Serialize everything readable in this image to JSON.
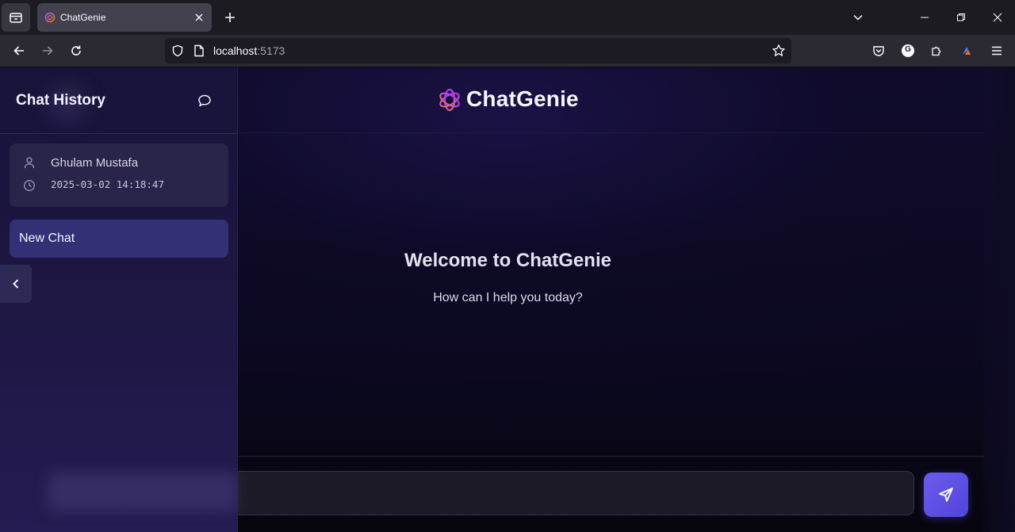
{
  "browser": {
    "tab_title": "ChatGenie",
    "url_host": "localhost",
    "url_port": ":5173",
    "extension_badge": "G"
  },
  "sidebar": {
    "title": "Chat History",
    "user": {
      "name": "Ghulam Mustafa",
      "timestamp": "2025-03-02 14:18:47"
    },
    "chats": [
      {
        "label": "New Chat"
      }
    ]
  },
  "header": {
    "brand": "ChatGenie"
  },
  "welcome": {
    "title": "Welcome to ChatGenie",
    "subtitle": "How can I help you today?"
  },
  "composer": {
    "placeholder": "",
    "value": ""
  },
  "colors": {
    "accent": "#5b4fe6",
    "sidebar_bg": "#1c1640",
    "active_chat_bg": "#343075",
    "app_bg": "#0b0820"
  }
}
